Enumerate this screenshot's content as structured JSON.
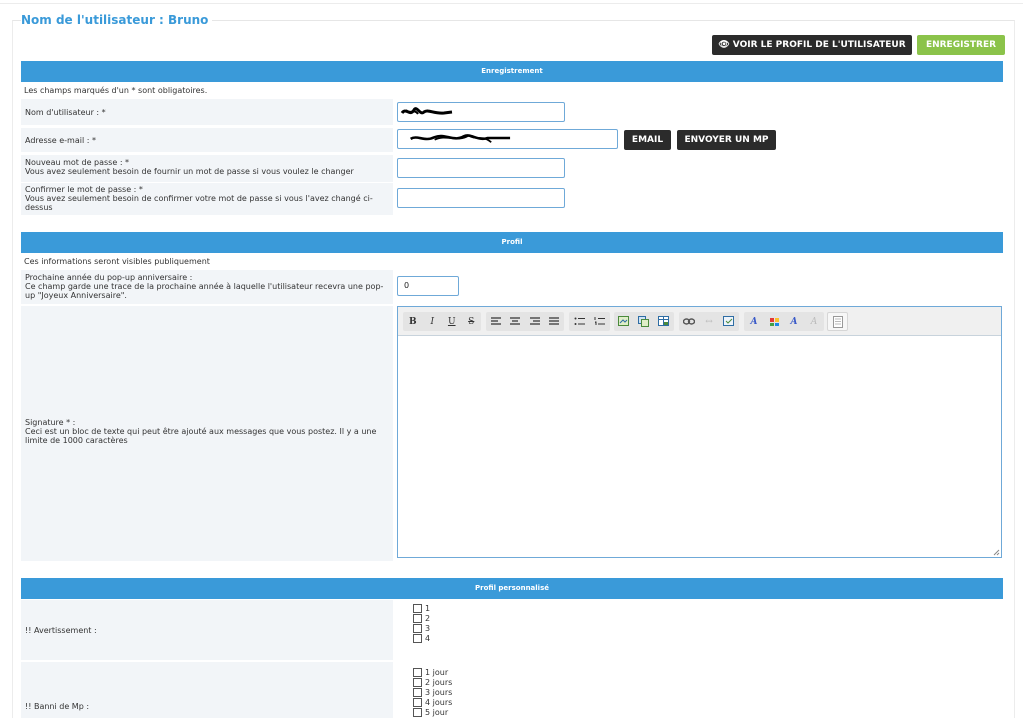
{
  "page_title": "Nom de l'utilisateur : Bruno",
  "actions": {
    "view_profile_label": "VOIR LE PROFIL DE L'UTILISATEUR",
    "save_label": "ENREGISTRER",
    "email_label": "EMAIL",
    "send_mp_label": "ENVOYER UN MP"
  },
  "registration": {
    "header": "Enregistrement",
    "note": "Les champs marqués d'un * sont obligatoires.",
    "username_label": "Nom d'utilisateur : *",
    "email_label": "Adresse e-mail : *",
    "new_password_label": "Nouveau mot de passe : *\nVous avez seulement besoin de fournir un mot de passe si vous voulez le changer",
    "confirm_password_label": "Confirmer le mot de passe : *\nVous avez seulement besoin de confirmer votre mot de passe si vous l'avez changé ci-dessus"
  },
  "profile": {
    "header": "Profil",
    "note": "Ces informations seront visibles publiquement",
    "birthday_label": "Prochaine année du pop-up anniversaire :\nCe champ garde une trace de la prochaine année à laquelle l'utilisateur recevra une pop-up \"Joyeux Anniversaire\".",
    "birthday_value": "0",
    "signature_label": "Signature * :\nCeci est un bloc de texte qui peut être ajouté aux messages que vous postez. Il y a une limite de 1000 caractères"
  },
  "toolbar": {
    "bold": "B",
    "italic": "I",
    "underline": "U",
    "strike": "S"
  },
  "custom_profile": {
    "header": "Profil personnalisé",
    "warning_label": "!! Avertissement :",
    "warning_options": [
      "1",
      "2",
      "3",
      "4"
    ],
    "ban_mp_label": "!! Banni de Mp :",
    "ban_mp_options": [
      "1 jour",
      "2 jours",
      "3 jours",
      "4 jours",
      "5 jour"
    ]
  },
  "colors": {
    "accent": "#3a9ad9",
    "dark_button": "#2b2b2b",
    "save_button": "#8bc34a",
    "label_background": "#f2f5f8"
  }
}
